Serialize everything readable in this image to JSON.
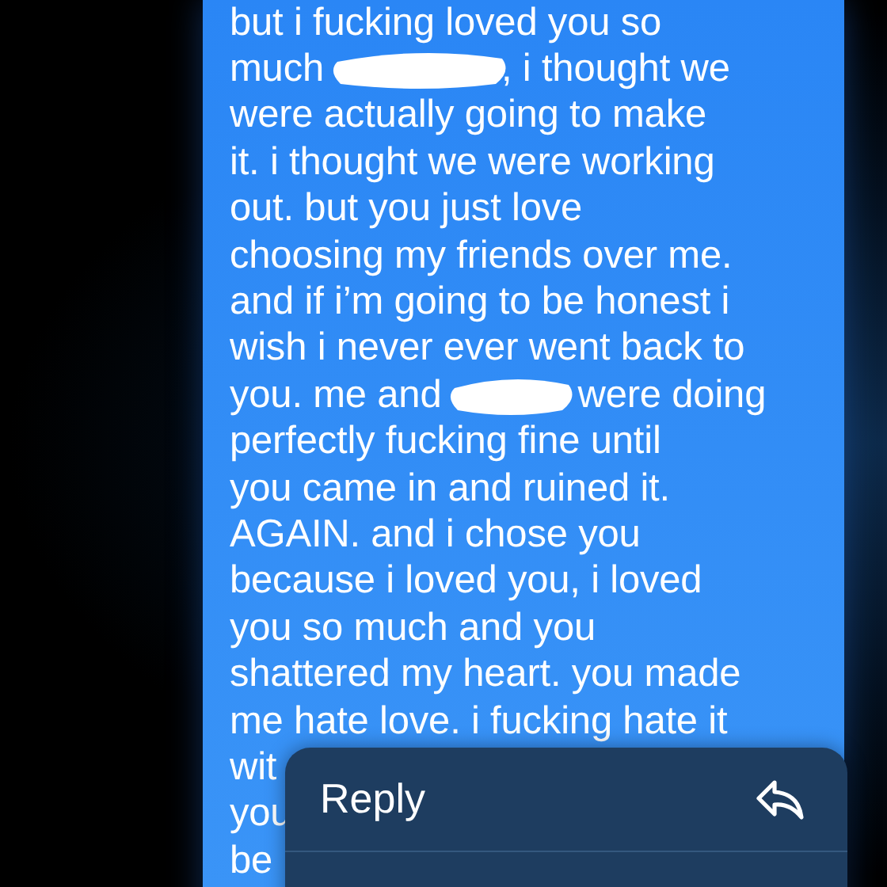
{
  "message": {
    "lines": [
      [
        {
          "kind": "text",
          "text": "but i fucking loved you so"
        }
      ],
      [
        {
          "kind": "text",
          "text": "much"
        },
        {
          "kind": "redaction"
        },
        {
          "kind": "text",
          "text": ", i thought we"
        }
      ],
      [
        {
          "kind": "text",
          "text": "were actually going to make"
        }
      ],
      [
        {
          "kind": "text",
          "text": "it. i thought we were working"
        }
      ],
      [
        {
          "kind": "text",
          "text": "out. but you just love"
        }
      ],
      [
        {
          "kind": "text",
          "text": "choosing my friends over me."
        }
      ],
      [
        {
          "kind": "text",
          "text": "and if i’m going to be honest i"
        }
      ],
      [
        {
          "kind": "text",
          "text": "wish i never ever went back to"
        }
      ],
      [
        {
          "kind": "text",
          "text": "you. me and"
        },
        {
          "kind": "redaction"
        },
        {
          "kind": "text",
          "text": "were doing"
        }
      ],
      [
        {
          "kind": "text",
          "text": "perfectly fucking fine until"
        }
      ],
      [
        {
          "kind": "text",
          "text": "you came in and ruined it."
        }
      ],
      [
        {
          "kind": "text",
          "text": "AGAIN. and i chose you"
        }
      ],
      [
        {
          "kind": "text",
          "text": "because i loved you, i loved"
        }
      ],
      [
        {
          "kind": "text",
          "text": "you so much and you"
        }
      ],
      [
        {
          "kind": "text",
          "text": "shattered my heart. you made"
        }
      ],
      [
        {
          "kind": "text",
          "text": "me hate love. i fucking hate it"
        }
      ],
      [
        {
          "kind": "text",
          "text": "wit"
        }
      ],
      [
        {
          "kind": "text",
          "text": "you"
        }
      ],
      [
        {
          "kind": "text",
          "text": "be"
        }
      ]
    ]
  },
  "context_menu": {
    "items": [
      {
        "label": "Reply"
      }
    ]
  }
}
